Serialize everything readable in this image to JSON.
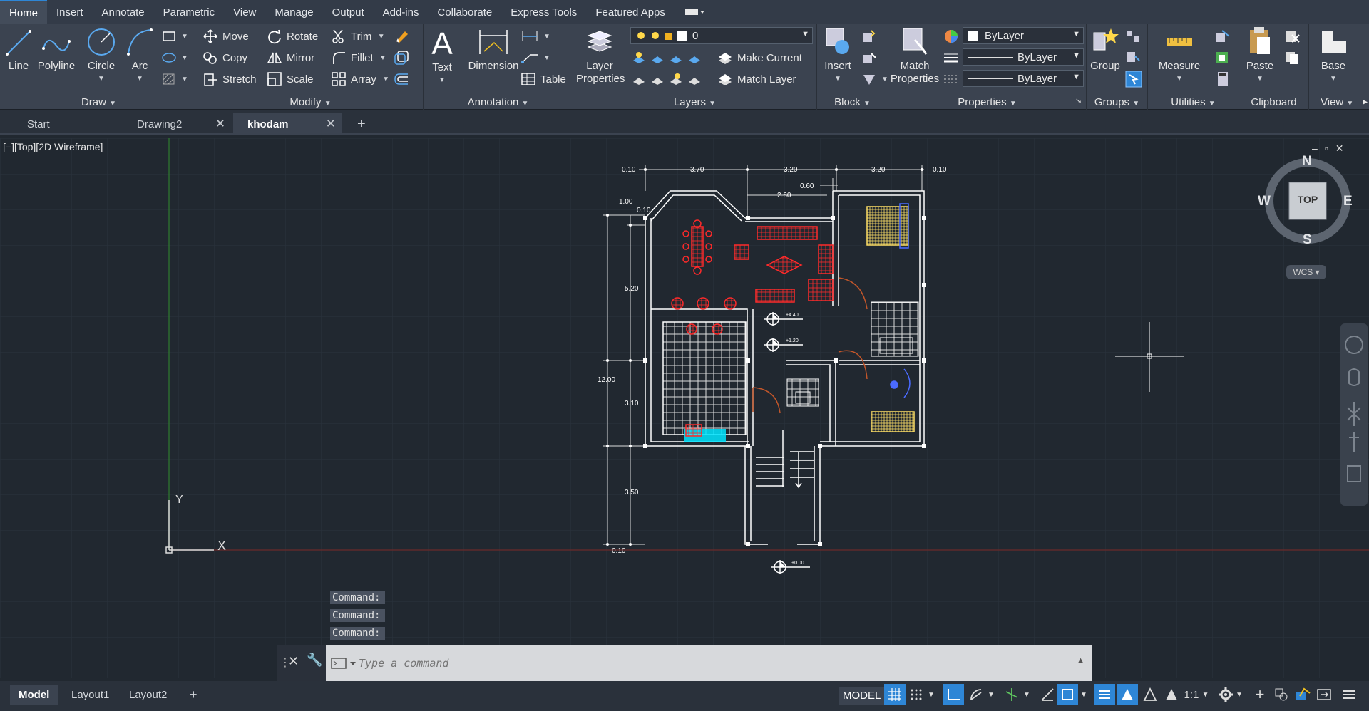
{
  "menu": {
    "tabs": [
      "Home",
      "Insert",
      "Annotate",
      "Parametric",
      "View",
      "Manage",
      "Output",
      "Add-ins",
      "Collaborate",
      "Express Tools",
      "Featured Apps"
    ],
    "active": "Home"
  },
  "ribbon": {
    "draw": {
      "title": "Draw",
      "line": "Line",
      "polyline": "Polyline",
      "circle": "Circle",
      "arc": "Arc"
    },
    "modify": {
      "title": "Modify",
      "move": "Move",
      "rotate": "Rotate",
      "trim": "Trim",
      "copy": "Copy",
      "mirror": "Mirror",
      "fillet": "Fillet",
      "stretch": "Stretch",
      "scale": "Scale",
      "array": "Array"
    },
    "annotation": {
      "title": "Annotation",
      "text": "Text",
      "dimension": "Dimension",
      "table": "Table"
    },
    "layers": {
      "title": "Layers",
      "layer_properties_1": "Layer",
      "layer_properties_2": "Properties",
      "layer_value": "0",
      "make_current": "Make Current",
      "match_layer": "Match Layer"
    },
    "block": {
      "title": "Block",
      "insert": "Insert"
    },
    "properties": {
      "title": "Properties",
      "match_1": "Match",
      "match_2": "Properties",
      "color": "ByLayer",
      "linetype": "ByLayer",
      "lineweight": "ByLayer"
    },
    "groups": {
      "title": "Groups",
      "group": "Group"
    },
    "utilities": {
      "title": "Utilities",
      "measure": "Measure"
    },
    "clipboard": {
      "title": "Clipboard",
      "paste": "Paste"
    },
    "view": {
      "title": "View",
      "base": "Base"
    }
  },
  "doc_tabs": {
    "start": "Start",
    "drawing2": "Drawing2",
    "khodam": "khodam",
    "active": "khodam"
  },
  "viewport": {
    "label": "[−][Top][2D Wireframe]",
    "viewcube": {
      "n": "N",
      "s": "S",
      "e": "E",
      "w": "W",
      "top": "TOP",
      "wcs": "WCS"
    },
    "ucs": {
      "x": "X",
      "y": "Y"
    },
    "dims": {
      "top": [
        "0.10",
        "3.70",
        "3.20",
        "3.20",
        "0.10"
      ],
      "upper": [
        "2.60",
        "0.60"
      ],
      "left": [
        "1.00",
        "0.10",
        "5.20",
        "12.00",
        "3.10",
        "3.50",
        "0.10"
      ],
      "levels": [
        "+4.40",
        "+1.20",
        "+0.00"
      ]
    }
  },
  "command": {
    "history": [
      "Command:",
      "Command:",
      "Command:"
    ],
    "placeholder": "Type a command"
  },
  "status": {
    "layouts": [
      "Model",
      "Layout1",
      "Layout2"
    ],
    "active_layout": "Model",
    "model_label": "MODEL",
    "scale": "1:1"
  },
  "colors": {
    "accent": "#2e86d6",
    "wall": "#ffffff",
    "furniture": "#ff2222",
    "fixture": "#ffe066",
    "hatch_cyan": "#00e5ff",
    "bg": "#212830"
  }
}
